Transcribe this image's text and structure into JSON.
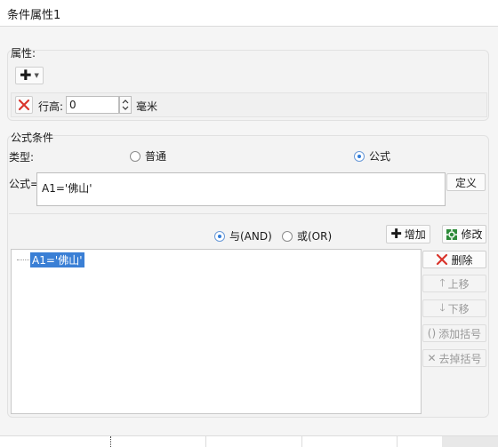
{
  "window": {
    "title": "条件属性1"
  },
  "properties": {
    "label": "属性:",
    "row_height_label": "行高:",
    "row_height_value": "0",
    "unit": "毫米"
  },
  "formula_condition": {
    "label": "公式条件",
    "type_label": "类型:",
    "type_options": [
      "普通",
      "公式"
    ],
    "selected_type": "公式",
    "formula_label": "公式=",
    "formula_value": "A1='佛山'",
    "define_button": "定义",
    "logic_options": [
      "与(AND)",
      "或(OR)"
    ],
    "selected_logic": "与(AND)",
    "add_button": "增加",
    "modify_button": "修改",
    "tree_items": [
      "A1='佛山'"
    ],
    "side_buttons": {
      "delete": "删除",
      "move_up": "上移",
      "move_down": "下移",
      "add_bracket": "添加括号",
      "remove_bracket": "去掉括号"
    }
  },
  "colors": {
    "accent": "#2f7bd8",
    "delete_red": "#d9342b",
    "selection": "#3a7fd5"
  },
  "icons": [
    "plus-icon",
    "dropdown-arrow-icon",
    "close-red-icon",
    "spinner-up-icon",
    "spinner-down-icon",
    "plus-icon",
    "edit-icon",
    "delete-icon",
    "arrow-up-icon",
    "arrow-down-icon",
    "add-bracket-icon",
    "remove-bracket-icon"
  ]
}
